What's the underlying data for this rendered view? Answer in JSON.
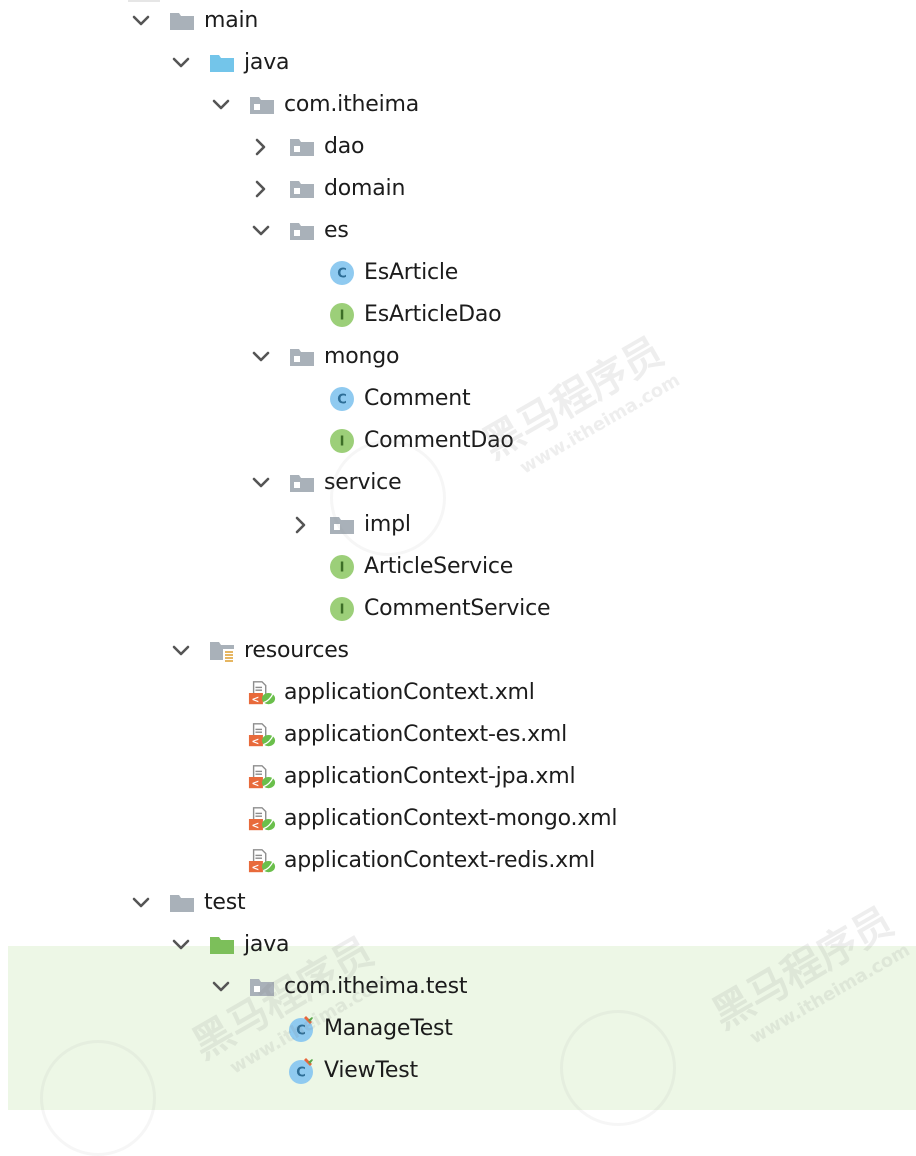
{
  "tree": [
    {
      "label": "main",
      "icon": "folder-gray-icon",
      "expanded": true
    },
    {
      "label": "java",
      "icon": "folder-source-blue-icon",
      "expanded": true
    },
    {
      "label": "com.itheima",
      "icon": "package-icon",
      "expanded": true
    },
    {
      "label": "dao",
      "icon": "package-icon",
      "expanded": false
    },
    {
      "label": "domain",
      "icon": "package-icon",
      "expanded": false
    },
    {
      "label": "es",
      "icon": "package-icon",
      "expanded": true
    },
    {
      "label": "EsArticle",
      "icon": "class-icon"
    },
    {
      "label": "EsArticleDao",
      "icon": "interface-icon"
    },
    {
      "label": "mongo",
      "icon": "package-icon",
      "expanded": true
    },
    {
      "label": "Comment",
      "icon": "class-icon"
    },
    {
      "label": "CommentDao",
      "icon": "interface-icon"
    },
    {
      "label": "service",
      "icon": "package-icon",
      "expanded": true
    },
    {
      "label": "impl",
      "icon": "package-icon",
      "expanded": false
    },
    {
      "label": "ArticleService",
      "icon": "interface-icon"
    },
    {
      "label": "CommentService",
      "icon": "interface-icon"
    },
    {
      "label": "resources",
      "icon": "folder-resources-icon",
      "expanded": true
    },
    {
      "label": "applicationContext.xml",
      "icon": "spring-xml-icon"
    },
    {
      "label": "applicationContext-es.xml",
      "icon": "spring-xml-icon"
    },
    {
      "label": "applicationContext-jpa.xml",
      "icon": "spring-xml-icon"
    },
    {
      "label": "applicationContext-mongo.xml",
      "icon": "spring-xml-icon"
    },
    {
      "label": "applicationContext-redis.xml",
      "icon": "spring-xml-icon"
    },
    {
      "label": "test",
      "icon": "folder-gray-icon",
      "expanded": true
    },
    {
      "label": "java",
      "icon": "folder-test-green-icon",
      "expanded": true
    },
    {
      "label": "com.itheima.test",
      "icon": "package-icon",
      "expanded": true
    },
    {
      "label": "ManageTest",
      "icon": "test-class-icon"
    },
    {
      "label": "ViewTest",
      "icon": "test-class-icon"
    }
  ],
  "watermark": {
    "brand": "黑马程序员",
    "site": "www.itheima.com"
  },
  "colors": {
    "highlight": "#edf7e6",
    "folder": "#a9b1b9",
    "source_folder": "#73c5ea",
    "test_folder": "#7cbf5a",
    "class": "#6fb5e0",
    "interface": "#8bc06b"
  }
}
